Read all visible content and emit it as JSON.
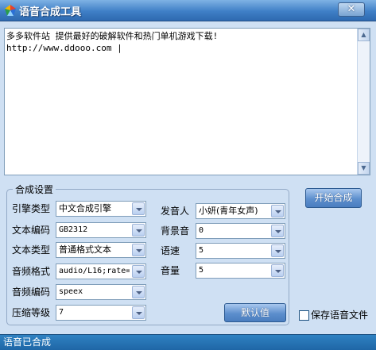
{
  "window": {
    "title": "语音合成工具",
    "close_glyph": "✕",
    "icon_name": "app-logo-icon"
  },
  "editor": {
    "text": "多多软件站 提供最好的破解软件和热门单机游戏下载!\nhttp://www.ddooo.com |"
  },
  "settings": {
    "group_title": "合成设置",
    "engine": {
      "label": "引擎类型",
      "value": "中文合成引擎"
    },
    "text_encoding": {
      "label": "文本编码",
      "value": "GB2312"
    },
    "text_type": {
      "label": "文本类型",
      "value": "普通格式文本"
    },
    "audio_format": {
      "label": "音频格式",
      "value": "audio/L16;rate="
    },
    "audio_codec": {
      "label": "音频编码",
      "value": "speex"
    },
    "compression": {
      "label": "压缩等级",
      "value": "7"
    },
    "speaker": {
      "label": "发音人",
      "value": "小妍(青年女声)"
    },
    "background": {
      "label": "背景音",
      "value": "0"
    },
    "speed": {
      "label": "语速",
      "value": "5"
    },
    "volume": {
      "label": "音量",
      "value": "5"
    },
    "default_button": "默认值"
  },
  "actions": {
    "start_button": "开始合成",
    "save_audio_label": "保存语音文件",
    "save_audio_checked": false
  },
  "status": {
    "text": "语音已合成"
  },
  "colors": {
    "titlebar": "#3f7fc6",
    "window_bg": "#cfe0f3",
    "button": "#5d8fcd",
    "statusbar": "#1f66a6"
  }
}
